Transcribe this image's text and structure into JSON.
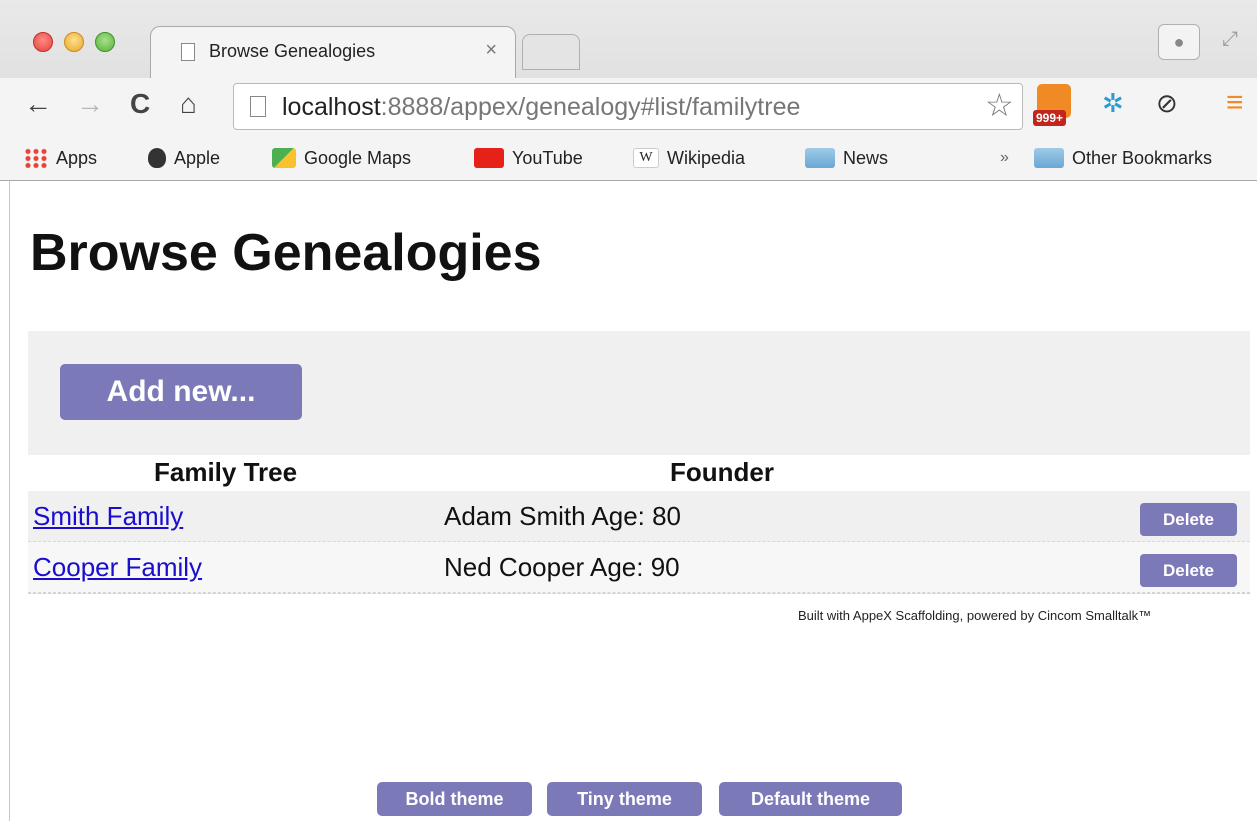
{
  "browser": {
    "tab_title": "Browse Genealogies",
    "tab_close": "×",
    "url_host": "localhost",
    "url_rest": ":8888/appex/genealogy#list/familytree",
    "rss_badge": "999+",
    "bookmarks": [
      {
        "label": "Apps"
      },
      {
        "label": "Apple"
      },
      {
        "label": "Google Maps"
      },
      {
        "label": "YouTube"
      },
      {
        "label": "Wikipedia",
        "icon_text": "W"
      },
      {
        "label": "News"
      },
      {
        "label": "»"
      },
      {
        "label": "Other Bookmarks"
      }
    ]
  },
  "page": {
    "title": "Browse Genealogies",
    "add_button": "Add new...",
    "table": {
      "columns": [
        "Family Tree",
        "Founder"
      ],
      "rows": [
        {
          "family": "Smith Family",
          "founder": "Adam Smith Age: 80",
          "action": "Delete"
        },
        {
          "family": "Cooper Family",
          "founder": "Ned Cooper Age: 90",
          "action": "Delete"
        }
      ]
    },
    "footer": "Built with AppeX Scaffolding, powered by Cincom Smalltalk™",
    "themes": [
      "Bold theme",
      "Tiny theme",
      "Default theme"
    ]
  },
  "colors": {
    "button": "#7c79b9",
    "link": "#1a0dcc",
    "panel": "#f0f0f0"
  },
  "icons": [
    "back-arrow-icon",
    "forward-arrow-icon",
    "reload-icon",
    "home-icon",
    "page-icon",
    "star-icon",
    "rss-icon",
    "extension-icon",
    "block-icon",
    "menu-icon",
    "folder-icon",
    "profile-icon"
  ]
}
